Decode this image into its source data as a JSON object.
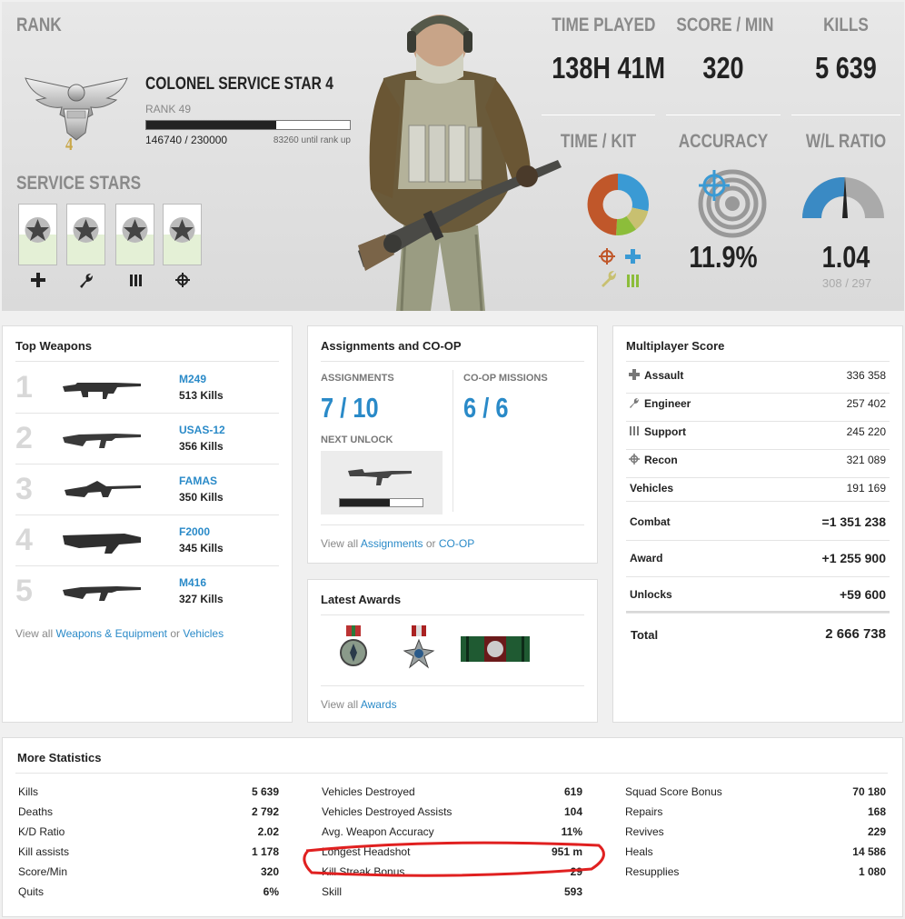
{
  "hero": {
    "rank_header": "RANK",
    "rank_title": "COLONEL SERVICE STAR 4",
    "rank_sub": "RANK 49",
    "rank_insignia_num": "4",
    "xp_current": "146740 / 230000",
    "xp_until": "83260 until rank up",
    "xp_progress": 0.638,
    "service_stars_header": "SERVICE STARS",
    "stats": [
      {
        "label": "TIME PLAYED",
        "value": "138H 41M"
      },
      {
        "label": "SCORE / MIN",
        "value": "320"
      },
      {
        "label": "KILLS",
        "value": "5 639"
      },
      {
        "label": "TIME / KIT",
        "value": ""
      },
      {
        "label": "ACCURACY",
        "value": "11.9%"
      },
      {
        "label": "W/L RATIO",
        "value": "1.04"
      }
    ],
    "wl_detail": "308 / 297",
    "colors": {
      "assault": "#c0572a",
      "engineer": "#3a9ad4",
      "support": "#8cbd3a",
      "recon": "#c8c070",
      "accent": "#2a8ac8"
    }
  },
  "top_weapons": {
    "title": "Top Weapons",
    "items": [
      {
        "rank": "1",
        "name": "M249",
        "kills": "513 Kills"
      },
      {
        "rank": "2",
        "name": "USAS-12",
        "kills": "356 Kills"
      },
      {
        "rank": "3",
        "name": "FAMAS",
        "kills": "350 Kills"
      },
      {
        "rank": "4",
        "name": "F2000",
        "kills": "345 Kills"
      },
      {
        "rank": "5",
        "name": "M416",
        "kills": "327 Kills"
      }
    ],
    "view_prefix": "View all",
    "view_link1": "Weapons & Equipment",
    "view_or": "or",
    "view_link2": "Vehicles"
  },
  "assignments": {
    "title": "Assignments and CO-OP",
    "assign_label": "ASSIGNMENTS",
    "assign_value": "7 / 10",
    "coop_label": "CO-OP MISSIONS",
    "coop_value": "6 / 6",
    "next_unlock_label": "NEXT UNLOCK",
    "unlock_progress": 0.6,
    "view_prefix": "View all",
    "view_link1": "Assignments",
    "view_or": "or",
    "view_link2": "CO-OP"
  },
  "awards": {
    "title": "Latest Awards",
    "view_prefix": "View all",
    "view_link": "Awards"
  },
  "mp_score": {
    "title": "Multiplayer Score",
    "rows": [
      {
        "label": "Assault",
        "value": "336 358",
        "icon": "assault-icon"
      },
      {
        "label": "Engineer",
        "value": "257 402",
        "icon": "engineer-icon"
      },
      {
        "label": "Support",
        "value": "245 220",
        "icon": "support-icon"
      },
      {
        "label": "Recon",
        "value": "321 089",
        "icon": "recon-icon"
      },
      {
        "label": "Vehicles",
        "value": "191 169"
      },
      {
        "label": "Combat",
        "value": "=1 351 238"
      },
      {
        "label": "Award",
        "value": "+1 255 900"
      },
      {
        "label": "Unlocks",
        "value": "+59 600"
      }
    ],
    "total_label": "Total",
    "total_value": "2 666 738"
  },
  "more_stats": {
    "title": "More Statistics",
    "col1": [
      {
        "label": "Kills",
        "value": "5 639"
      },
      {
        "label": "Deaths",
        "value": "2 792"
      },
      {
        "label": "K/D Ratio",
        "value": "2.02"
      },
      {
        "label": "Kill assists",
        "value": "1 178"
      },
      {
        "label": "Score/Min",
        "value": "320"
      },
      {
        "label": "Quits",
        "value": "6%"
      }
    ],
    "col2": [
      {
        "label": "Vehicles Destroyed",
        "value": "619"
      },
      {
        "label": "Vehicles Destroyed Assists",
        "value": "104"
      },
      {
        "label": "Avg. Weapon Accuracy",
        "value": "11%"
      },
      {
        "label": "Longest Headshot",
        "value": "951 m"
      },
      {
        "label": "Kill Streak Bonus",
        "value": "29"
      },
      {
        "label": "Skill",
        "value": "593"
      }
    ],
    "col3": [
      {
        "label": "Squad Score Bonus",
        "value": "70 180"
      },
      {
        "label": "Repairs",
        "value": "168"
      },
      {
        "label": "Revives",
        "value": "229"
      },
      {
        "label": "Heals",
        "value": "14 586"
      },
      {
        "label": "Resupplies",
        "value": "1 080"
      }
    ]
  }
}
